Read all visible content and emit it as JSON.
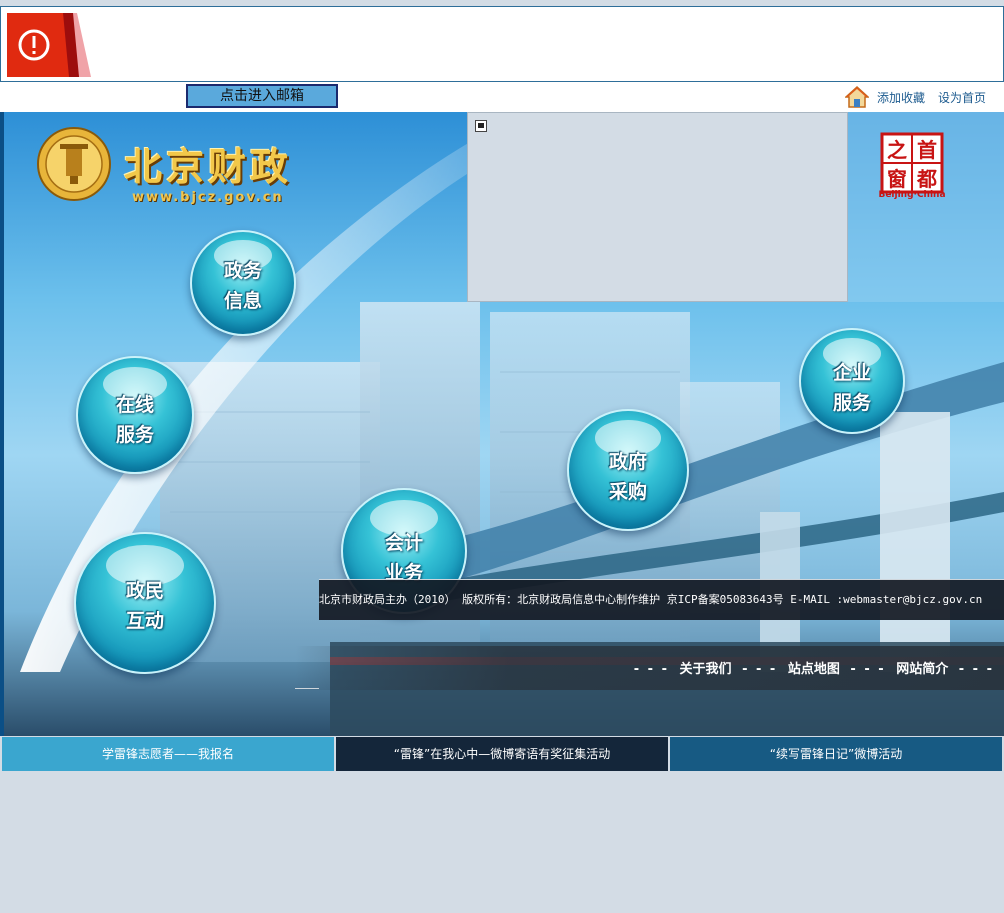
{
  "alert": {
    "icon": "alert-circle-icon"
  },
  "topbar": {
    "mail_button": "点击进入邮箱",
    "home_icon": "home-icon",
    "add_favorite": "添加收藏",
    "set_homepage": "设为首页"
  },
  "hero": {
    "logo_title": "北京财政",
    "logo_url": "www.bjcz.gov.cn",
    "capital_badge": {
      "chars": [
        "之",
        "首",
        "窗",
        "都"
      ],
      "en": "Beijing·China"
    },
    "bubbles": [
      {
        "line1": "政务",
        "line2": "信息"
      },
      {
        "line1": "在线",
        "line2": "服务"
      },
      {
        "line1": "政民",
        "line2": "互动"
      },
      {
        "line1": "会计",
        "line2": "业务"
      },
      {
        "line1": "政府",
        "line2": "采购"
      },
      {
        "line1": "企业",
        "line2": "服务"
      }
    ],
    "nav": {
      "about": "关于我们",
      "sitemap": "站点地图",
      "intro": "网站简介",
      "sep": "- - -"
    },
    "copyright": "北京市财政局主办（2010） 版权所有：北京财政局信息中心制作维护 京ICP备案05083643号 E-MAIL :webmaster@bjcz.gov.cn"
  },
  "bottom_links": [
    {
      "label": "学雷锋志愿者——我报名",
      "color": "#3aa6cf"
    },
    {
      "label": "“雷锋”在我心中—微博寄语有奖征集活动",
      "color": "#14263a"
    },
    {
      "label": "“续写雷锋日记”微博活动",
      "color": "#175a83"
    }
  ],
  "colors": {
    "page_bg": "#d3dce5",
    "alert_border": "#2e6e99",
    "link": "#1d5b8f"
  }
}
